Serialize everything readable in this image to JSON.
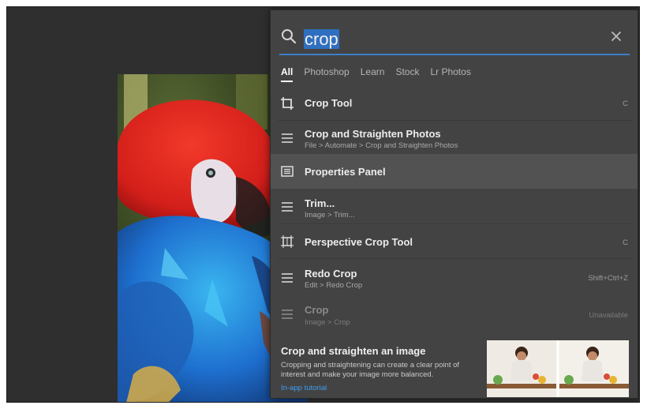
{
  "search": {
    "query": "crop"
  },
  "tabs": [
    {
      "label": "All",
      "active": true
    },
    {
      "label": "Photoshop",
      "active": false
    },
    {
      "label": "Learn",
      "active": false
    },
    {
      "label": "Stock",
      "active": false
    },
    {
      "label": "Lr Photos",
      "active": false
    }
  ],
  "results": [
    {
      "title": "Crop Tool",
      "path": "",
      "shortcut": "C",
      "icon": "crop-icon",
      "enabled": true
    },
    {
      "title": "Crop and Straighten Photos",
      "path": "File > Automate > Crop and Straighten Photos",
      "shortcut": "",
      "icon": "menu-icon",
      "enabled": true
    },
    {
      "title": "Properties Panel",
      "path": "",
      "shortcut": "",
      "icon": "panel-icon",
      "enabled": true
    },
    {
      "title": "Trim...",
      "path": "Image > Trim...",
      "shortcut": "",
      "icon": "menu-icon",
      "enabled": true
    },
    {
      "title": "Perspective Crop Tool",
      "path": "",
      "shortcut": "C",
      "icon": "perspective-crop-icon",
      "enabled": true
    },
    {
      "title": "Redo Crop",
      "path": "Edit > Redo Crop",
      "shortcut": "Shift+Ctrl+Z",
      "icon": "menu-icon",
      "enabled": true
    },
    {
      "title": "Crop",
      "path": "Image > Crop",
      "shortcut": "Unavailable",
      "icon": "menu-icon",
      "enabled": false
    }
  ],
  "tutorial": {
    "title": "Crop and straighten an image",
    "description": "Cropping and straightening can create a clear point of interest and make your image more balanced.",
    "link_label": "In-app tutorial"
  },
  "colors": {
    "accent": "#3d7ec8",
    "panel_bg": "#434343",
    "link": "#3f9cf2"
  }
}
